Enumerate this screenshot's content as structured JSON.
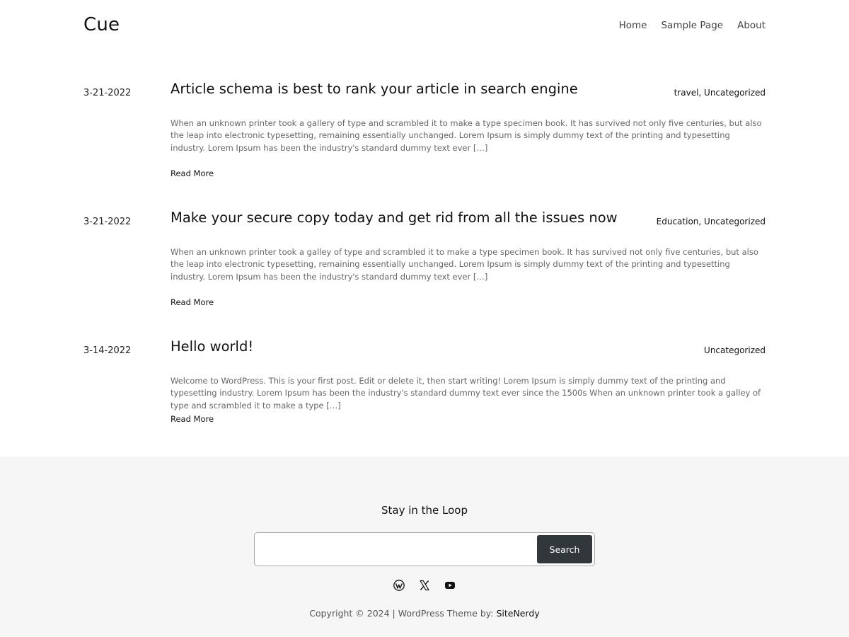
{
  "site": {
    "title": "Cue"
  },
  "nav": {
    "items": [
      {
        "label": "Home"
      },
      {
        "label": "Sample Page"
      },
      {
        "label": "About"
      }
    ]
  },
  "posts": [
    {
      "date": "3-21-2022",
      "title": "Article schema is best to rank your article in search engine",
      "categories": [
        "travel",
        "Uncategorized"
      ],
      "excerpt": "When an unknown printer took a gallery of type and scrambled it to make a type specimen book. It has survived not only five centuries, but also the leap into electronic typesetting, remaining essentially unchanged. Lorem Ipsum is simply dummy text of the printing and typesetting industry. Lorem Ipsum has been the industry's standard dummy text ever […]",
      "read_more": "Read More"
    },
    {
      "date": "3-21-2022",
      "title": "Make your secure copy today and get rid from all the issues now",
      "categories": [
        "Education",
        "Uncategorized"
      ],
      "excerpt": "When an unknown printer took a galley of type and scrambled it to make a type specimen book. It has survived not only five centuries, but also the leap into electronic typesetting, remaining essentially unchanged. Lorem Ipsum is simply dummy text of the printing and typesetting industry. Lorem Ipsum has been the industry's standard dummy text ever […]",
      "read_more": "Read More"
    },
    {
      "date": "3-14-2022",
      "title": "Hello world!",
      "categories": [
        "Uncategorized"
      ],
      "excerpt": "Welcome to WordPress. This is your first post. Edit or delete it, then start writing! Lorem Ipsum is simply dummy text of the printing and typesetting industry. Lorem Ipsum has been the industry's standard dummy text ever since the 1500s When an unknown printer took a galley of type and scrambled it to make a type […]",
      "read_more": "Read More"
    }
  ],
  "footer": {
    "heading": "Stay in the Loop",
    "search": {
      "value": "",
      "button_label": "Search"
    },
    "social_icons": [
      "wordpress-icon",
      "x-icon",
      "youtube-icon"
    ],
    "copyright_text": "Copyright © 2024 | WordPress Theme by: ",
    "copyright_link": "SiteNerdy",
    "search_button_color": "#32373c",
    "background_color": "#f6f6f6"
  }
}
